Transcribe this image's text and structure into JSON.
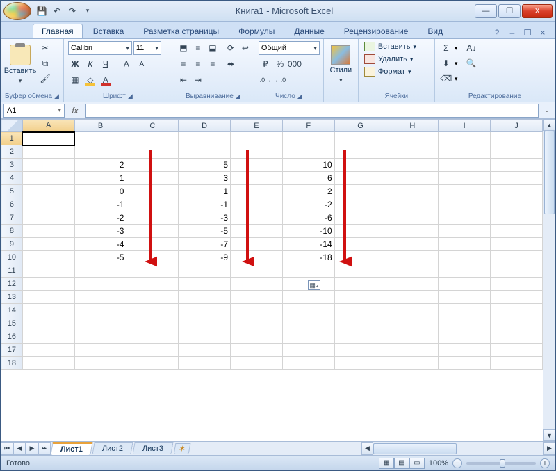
{
  "titlebar": {
    "title": "Книга1 - Microsoft Excel"
  },
  "win_buttons": {
    "min": "—",
    "max": "❐",
    "close": "X"
  },
  "tabs": {
    "items": [
      "Главная",
      "Вставка",
      "Разметка страницы",
      "Формулы",
      "Данные",
      "Рецензирование",
      "Вид"
    ],
    "active_index": 0
  },
  "doc_win": {
    "min": "–",
    "max": "❐",
    "close": "×",
    "help": "?"
  },
  "ribbon": {
    "clipboard": {
      "label": "Буфер обмена",
      "paste": "Вставить"
    },
    "font": {
      "label": "Шрифт",
      "name": "Calibri",
      "size": "11",
      "bold": "Ж",
      "italic": "К",
      "underline": "Ч"
    },
    "alignment": {
      "label": "Выравнивание"
    },
    "number": {
      "label": "Число",
      "format": "Общий",
      "percent": "%",
      "thousands": "000"
    },
    "styles": {
      "label": "Стили"
    },
    "cells": {
      "label": "Ячейки",
      "insert": "Вставить",
      "delete": "Удалить",
      "format": "Формат"
    },
    "editing": {
      "label": "Редактирование",
      "sigma": "Σ"
    }
  },
  "formula_bar": {
    "cell_ref": "A1",
    "fx": "fx",
    "value": ""
  },
  "grid": {
    "columns": [
      "A",
      "B",
      "C",
      "D",
      "E",
      "F",
      "G",
      "H",
      "I",
      "J"
    ],
    "row_count": 18,
    "selected_cell": "A1",
    "data": {
      "3": {
        "B": "2",
        "D": "5",
        "F": "10"
      },
      "4": {
        "B": "1",
        "D": "3",
        "F": "6"
      },
      "5": {
        "B": "0",
        "D": "1",
        "F": "2"
      },
      "6": {
        "B": "-1",
        "D": "-1",
        "F": "-2"
      },
      "7": {
        "B": "-2",
        "D": "-3",
        "F": "-6"
      },
      "8": {
        "B": "-3",
        "D": "-5",
        "F": "-10"
      },
      "9": {
        "B": "-4",
        "D": "-7",
        "F": "-14"
      },
      "10": {
        "B": "-5",
        "D": "-9",
        "F": "-18"
      }
    }
  },
  "sheet_tabs": {
    "items": [
      "Лист1",
      "Лист2",
      "Лист3"
    ],
    "active_index": 0
  },
  "status_bar": {
    "ready": "Готово",
    "zoom": "100%"
  }
}
